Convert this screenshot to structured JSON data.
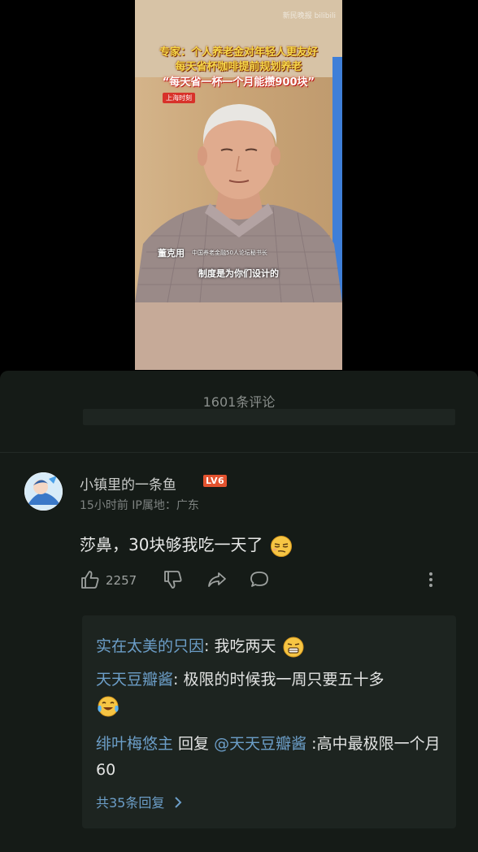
{
  "video": {
    "watermark": "新民晚报 bilibili",
    "headline_line1": "专家：个人养老金对年轻人更友好",
    "headline_line2": "每天省杯咖啡提前规划养老",
    "headline_line3": "“每天省一杯一个月能攒900块”",
    "source_badge": "上海时刻",
    "speaker_name": "董克用",
    "speaker_title": "中国养老金融50人论坛秘书长",
    "subtitle": "制度是为你们设计的"
  },
  "comments": {
    "count_label": "1601条评论",
    "main": {
      "username": "小镇里的一条鱼",
      "level_badge": "LV6",
      "meta": "15小时前  IP属地：广东",
      "text": "莎鼻，30块够我吃一天了",
      "emoji": "smug-face-emoji",
      "like_count": "2257"
    },
    "replies": [
      {
        "name": "实在太美的只因",
        "sep": ": ",
        "text": "我吃两天",
        "emoji": "grimace-emoji"
      },
      {
        "name": "天天豆瓣酱",
        "sep": ": ",
        "text": "极限的时候我一周只要五十多",
        "emoji": "crying-laugh-emoji"
      },
      {
        "name": "绯叶梅悠主",
        "reply_word": " 回复 ",
        "mention": "@天天豆瓣酱",
        "text": " :高中最极限一个月60"
      }
    ],
    "more_label": "共35条回复",
    "colors": {
      "link": "#6c9ec8",
      "panel_bg": "#151b17",
      "reply_bg": "#1d2420"
    }
  }
}
